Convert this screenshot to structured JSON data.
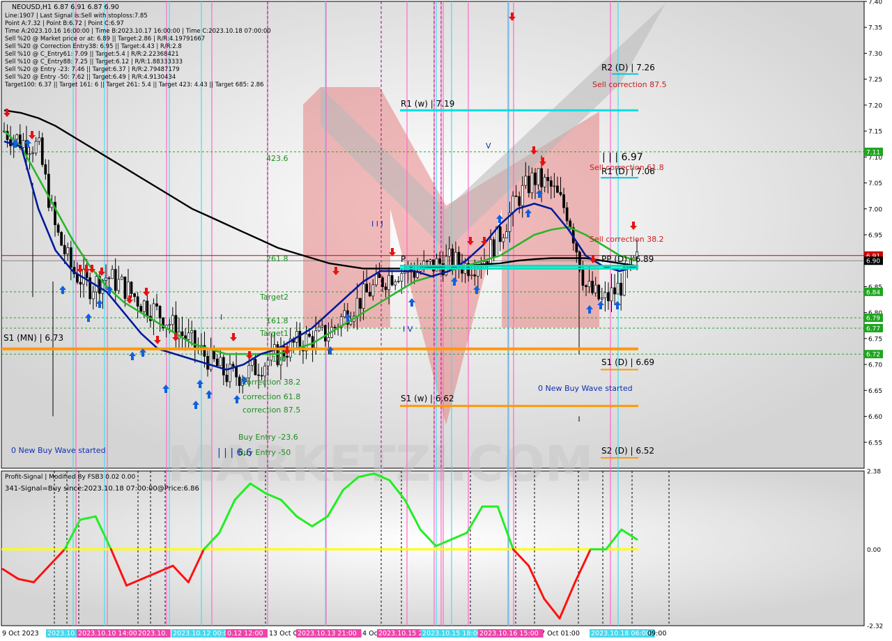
{
  "header": {
    "symbol_line": "NEOUSD,H1  6.87 6.91 6.87 6.90",
    "info_lines": [
      "Line:1907 | Last Signal is:Sell with stoploss:7.85",
      "Point A:7.32 | Point B:6.72 | Point C:6.97",
      "Time A:2023.10.16 16:00:00 | Time B:2023.10.17 16:00:00 | Time C:2023.10.18 07:00:00",
      "Sell %20 @ Market price or at: 6.89 || Target:2.86 | R/R:4.19791667",
      "Sell %20 @ Correction Entry38: 6.95 || Target:4.43 | R/R:2.8",
      "Sell %10 @ C_Entry61: 7.09 || Target:5.4 | R/R:2.22368421",
      "Sell %10 @ C_Entry88: 7.25 || Target:6.12 | R/R:1.88333333",
      "Sell %20 @ Entry -23: 7.46 || Target:6.37 | R/R:2.79487179",
      "Sell %20 @ Entry -50: 7.62 || Target:6.49 | R/R:4.9130434",
      "Target100: 6.37 || Target 161: 6 || Target 261: 5.4 || Target 423: 4.43 || Target 685: 2.86"
    ]
  },
  "chart_data": {
    "type": "line",
    "symbol": "NEOUSD",
    "timeframe": "H1",
    "ylim": [
      6.5,
      7.4
    ],
    "yticks": [
      "7.40",
      "7.35",
      "7.30",
      "7.25",
      "7.20",
      "7.15",
      "7.10",
      "7.05",
      "7.00",
      "6.95",
      "6.90",
      "6.85",
      "6.80",
      "6.75",
      "6.70",
      "6.65",
      "6.60",
      "6.55"
    ],
    "xlabels": [
      "9 Oct 2023",
      "13 Oct 01",
      "14 Oct",
      "7 Oct 01:00"
    ],
    "highlighted_xlabels": [
      {
        "text": "2023.10.1",
        "color": "#44d8ee"
      },
      {
        "text": "2023.10.10 14:00",
        "color": "#ee44aa"
      },
      {
        "text": "2023.10.",
        "color": "#ee44aa"
      },
      {
        "text": "2023.10.12 00:00",
        "color": "#44d8ee"
      },
      {
        "text": "0.12 12:00",
        "color": "#ee44aa"
      },
      {
        "text": "2023.10.13 21:00",
        "color": "#ee44aa"
      },
      {
        "text": "2023.10.15 20",
        "color": "#ee44aa"
      },
      {
        "text": "2023.10.15 18:00",
        "color": "#44d8ee"
      },
      {
        "text": "2023.10.16 15:00",
        "color": "#ee44aa"
      },
      {
        "text": "2023.10.18 06:00",
        "color": "#44d8ee"
      },
      {
        "text": "09:00",
        "color": ""
      }
    ],
    "price_badges": [
      {
        "price": 7.11,
        "text": "7.11",
        "color": "#1fa51f"
      },
      {
        "price": 6.91,
        "text": "6.91",
        "color": "#cc0000"
      },
      {
        "price": 6.9,
        "text": "6.90",
        "color": "#000000"
      },
      {
        "price": 6.84,
        "text": "6.84",
        "color": "#1fa51f"
      },
      {
        "price": 6.79,
        "text": "6.79",
        "color": "#1fa51f"
      },
      {
        "price": 6.77,
        "text": "6.77",
        "color": "#1fa51f"
      },
      {
        "price": 6.72,
        "text": "6.72",
        "color": "#1fa51f"
      }
    ],
    "levels": [
      {
        "text": "R2 (D) | 7.26",
        "price": 7.26,
        "color": "#00c8e0"
      },
      {
        "text": "R1 (w) | 7.19",
        "price": 7.19,
        "color": "#00e0e0"
      },
      {
        "text": "R1 (D) | 7.06",
        "price": 7.06,
        "color": "#00c8e0"
      },
      {
        "text": "PP (D) | 6.89",
        "price": 6.89,
        "color": "#00e0c0"
      },
      {
        "text": "P",
        "price": 6.89,
        "color": "#00e0c0"
      },
      {
        "text": "S1 (MN) | 6.73",
        "price": 6.73,
        "color": "#ff9900"
      },
      {
        "text": "S1 (D) | 6.69",
        "price": 6.69,
        "color": "#ff9900"
      },
      {
        "text": "S1 (w) | 6.62",
        "price": 6.62,
        "color": "#ff9900"
      },
      {
        "text": "S2 (D) | 6.52",
        "price": 6.52,
        "color": "#ff9900"
      }
    ],
    "annotations_green": [
      "423.6",
      "261.8",
      "Target2",
      "161.8",
      "Target1",
      "100",
      "correction 38.2",
      "correction 61.8",
      "correction 87.5",
      "Buy Entry -23.6",
      "Buy Entry -50"
    ],
    "annotations_red": [
      "Sell correction 87.5",
      "Sell correction 61.8",
      "Sell correction 38.2"
    ],
    "annotations_blue": [
      "0 New Buy Wave started",
      "0 New Buy Wave started",
      "| | | 6.6",
      "| | | 6.97",
      "V",
      "I V",
      "I I I",
      "I"
    ],
    "series": [
      {
        "name": "",
        "color": "#000000",
        "y": [
          7.19,
          7.185,
          7.175,
          7.16,
          7.14,
          7.12,
          7.1,
          7.08,
          7.06,
          7.04,
          7.02,
          7.0,
          6.985,
          6.97,
          6.955,
          6.94,
          6.925,
          6.915,
          6.905,
          6.895,
          6.89,
          6.885,
          6.885,
          6.885,
          6.885,
          6.887,
          6.89,
          6.89,
          6.893,
          6.895,
          6.9,
          6.903,
          6.905,
          6.905,
          6.905,
          6.9,
          6.895,
          6.89
        ]
      },
      {
        "name": "",
        "color": "#2ab52a",
        "y": [
          7.15,
          7.12,
          7.06,
          7.0,
          6.94,
          6.89,
          6.85,
          6.82,
          6.8,
          6.78,
          6.76,
          6.74,
          6.73,
          6.72,
          6.72,
          6.72,
          6.72,
          6.73,
          6.74,
          6.76,
          6.78,
          6.8,
          6.82,
          6.84,
          6.86,
          6.87,
          6.88,
          6.89,
          6.9,
          6.91,
          6.93,
          6.95,
          6.96,
          6.965,
          6.95,
          6.93,
          6.91,
          6.9
        ]
      },
      {
        "name": "",
        "color": "#001a99",
        "y": [
          7.13,
          7.12,
          7.0,
          6.92,
          6.88,
          6.86,
          6.84,
          6.8,
          6.76,
          6.73,
          6.72,
          6.71,
          6.7,
          6.69,
          6.7,
          6.72,
          6.73,
          6.75,
          6.77,
          6.8,
          6.83,
          6.86,
          6.88,
          6.88,
          6.88,
          6.87,
          6.88,
          6.9,
          6.93,
          6.97,
          7.0,
          7.01,
          7.0,
          6.96,
          6.91,
          6.89,
          6.88,
          6.89
        ]
      }
    ],
    "candles_close": [
      7.15,
      7.13,
      7.12,
      6.96,
      6.88,
      6.85,
      6.87,
      6.85,
      6.82,
      6.8,
      6.77,
      6.74,
      6.71,
      6.68,
      6.68,
      6.7,
      6.72,
      6.74,
      6.75,
      6.76,
      6.8,
      6.83,
      6.86,
      6.88,
      6.88,
      6.89,
      6.9,
      6.89,
      6.9,
      6.95,
      7.02,
      7.06,
      7.04,
      6.99,
      6.85,
      6.82,
      6.85,
      6.9
    ],
    "oscillator": {
      "title": "Profit-Signal | Modified By FSB3 0.02 0.00",
      "signal_text": "341-Signal=Buy since:2023.10.18 07:00:00@Price:6.86",
      "ylim": [
        -2.32,
        2.38
      ],
      "yticks": [
        "2.38",
        "0.00",
        "-2.32"
      ],
      "values": [
        -0.6,
        -0.9,
        -1.0,
        -0.5,
        0.0,
        0.9,
        1.0,
        0.0,
        -1.1,
        -0.9,
        -0.7,
        -0.5,
        -1.0,
        0.0,
        0.5,
        1.5,
        2.0,
        1.7,
        1.5,
        1.0,
        0.7,
        1.0,
        1.8,
        2.2,
        2.3,
        2.1,
        1.5,
        0.6,
        0.1,
        0.3,
        0.5,
        1.3,
        1.3,
        0.0,
        -0.5,
        -1.5,
        -2.1,
        -1.0,
        0.0,
        0.0,
        0.6,
        0.3
      ],
      "zero_color": "#ffff00"
    }
  },
  "colors": {
    "bull": "#1fa51f",
    "bear": "#cc0000",
    "magenta_line": "#ff69c8",
    "cyan_line": "#3fe0ef",
    "watermark": "#e89090"
  }
}
